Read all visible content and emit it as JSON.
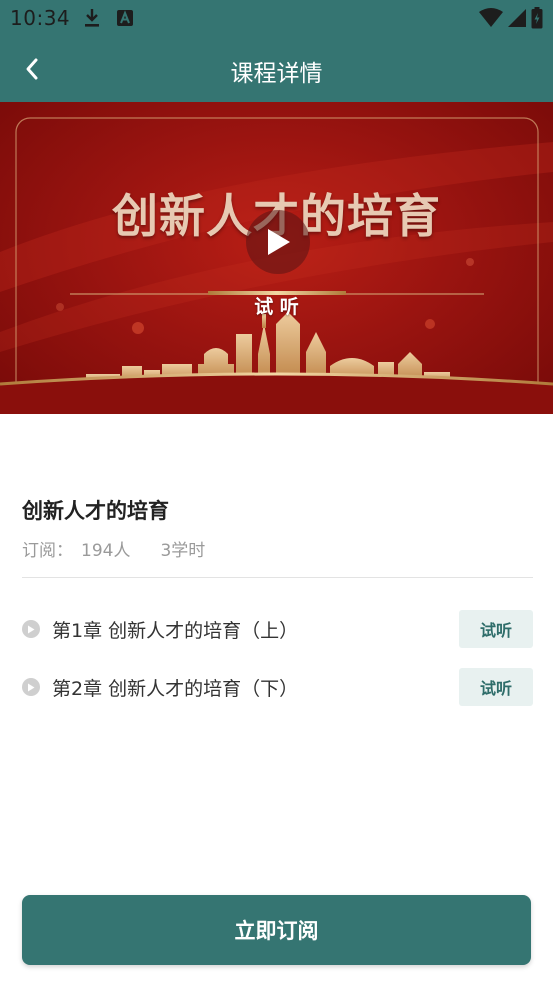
{
  "status_bar": {
    "time": "10:34",
    "icons": [
      "download-icon",
      "a-badge-icon",
      "wifi-icon",
      "signal-icon",
      "battery-icon"
    ]
  },
  "header": {
    "title": "课程详情",
    "back_icon": "chevron-left-icon"
  },
  "video": {
    "banner_title": "创新人才的培育",
    "trial_label": "试 听",
    "play_icon": "play-icon"
  },
  "course": {
    "title": "创新人才的培育",
    "subscribers_label": "订阅：",
    "subscribers": "194人",
    "hours": "3学时"
  },
  "chapters": [
    {
      "label": "第1章 创新人才的培育（上）",
      "action": "试听"
    },
    {
      "label": "第2章 创新人才的培育（下）",
      "action": "试听"
    }
  ],
  "footer": {
    "subscribe_label": "立即订阅"
  },
  "colors": {
    "primary": "#357572",
    "banner_red": "#9a1410",
    "gold": "#e7c9b2",
    "trial_bg": "#e8f1f0"
  }
}
